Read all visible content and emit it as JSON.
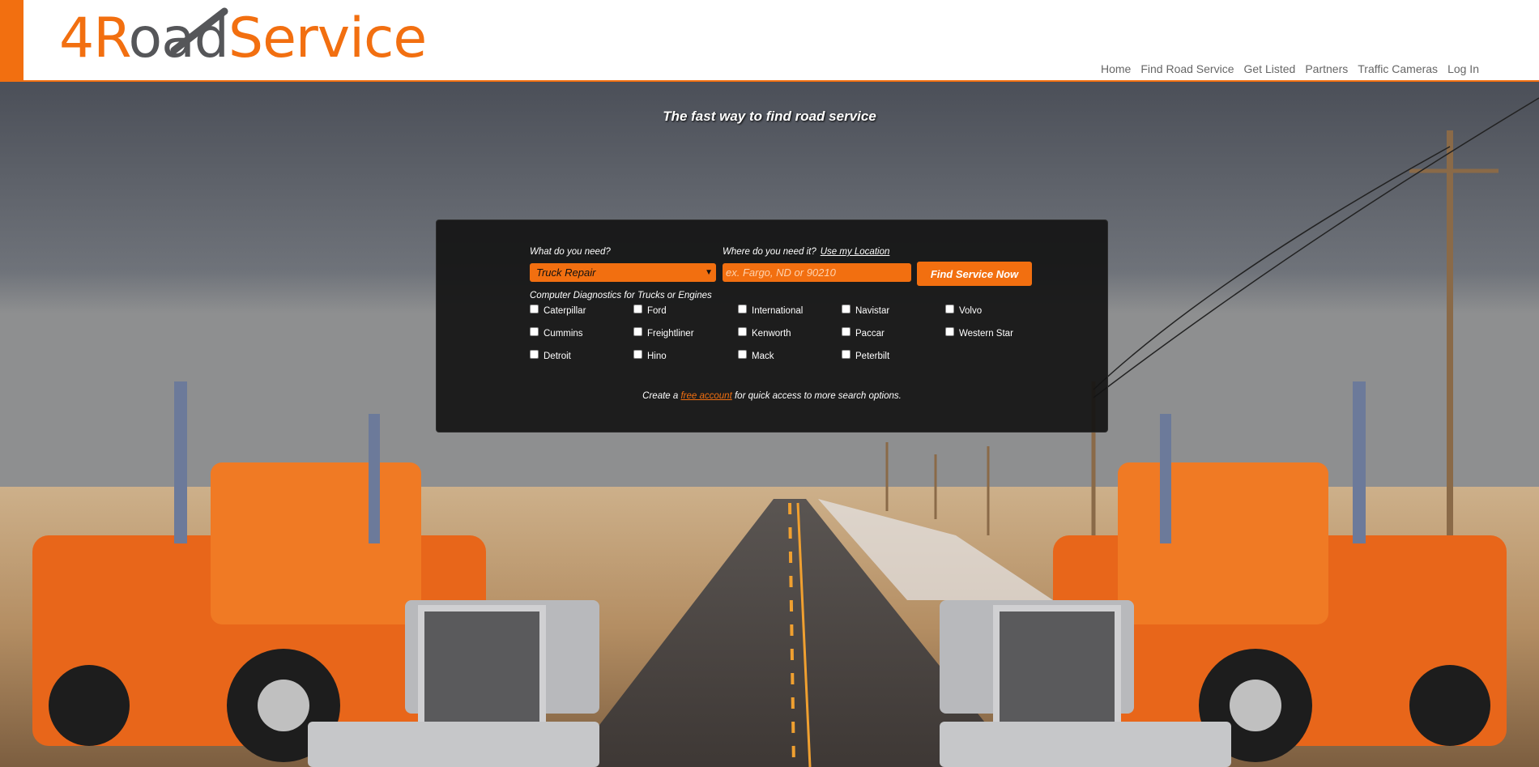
{
  "logo": {
    "part1": "4R",
    "part2": "oad",
    "part3": "Service"
  },
  "nav": [
    "Home",
    "Find Road Service",
    "Get Listed",
    "Partners",
    "Traffic Cameras",
    "Log In"
  ],
  "hero": {
    "tagline": "The fast way to find road service"
  },
  "search": {
    "need_label": "What do you need?",
    "need_value": "Truck Repair",
    "where_label": "Where do you need it?",
    "use_location": "Use my Location",
    "where_placeholder": "ex. Fargo, ND or 90210",
    "button": "Find Service Now",
    "diagnostics_title": "Computer Diagnostics for Trucks or Engines",
    "brands": [
      "Caterpillar",
      "Ford",
      "International",
      "Navistar",
      "Volvo",
      "Cummins",
      "Freightliner",
      "Kenworth",
      "Paccar",
      "Western Star",
      "Detroit",
      "Hino",
      "Mack",
      "Peterbilt"
    ],
    "create_prefix": "Create a",
    "create_link": "free account",
    "create_suffix": "for quick access to more search options."
  },
  "colors": {
    "accent": "#f26f10",
    "nav_text": "#666666",
    "panel": "#141414"
  }
}
